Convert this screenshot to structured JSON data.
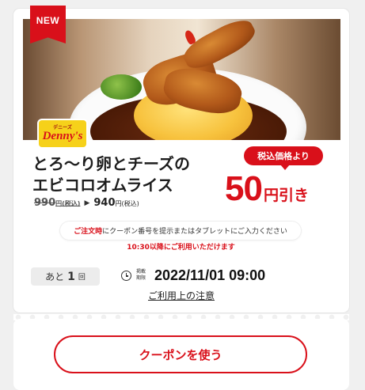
{
  "badge": {
    "label": "NEW"
  },
  "brand": {
    "logo_text": "Denny's",
    "logo_small": "デニーズ"
  },
  "product": {
    "title_line1": "とろ～り卵とチーズの",
    "title_line2": "エビコロオムライス",
    "old_price": "990",
    "old_price_unit": "円(税込)",
    "new_price": "940",
    "new_price_unit": "円(税込)"
  },
  "discount": {
    "tax_label": "税込価格より",
    "amount": "50",
    "unit": "円引き"
  },
  "notice": {
    "highlight": "ご注文時",
    "rest": "にクーポン番号を提示またはタブレットにご入力ください"
  },
  "time_note": "10:30以降にご利用いただけます",
  "remaining": {
    "prefix": "あと",
    "count": "1",
    "suffix": "回"
  },
  "expiry": {
    "label": "掲載期限",
    "datetime": "2022/11/01 09:00"
  },
  "caution_link": "ご利用上の注意",
  "use_button": "クーポンを使う",
  "colors": {
    "accent": "#d9101a",
    "background": "#f0f0f0",
    "card": "#ffffff"
  }
}
